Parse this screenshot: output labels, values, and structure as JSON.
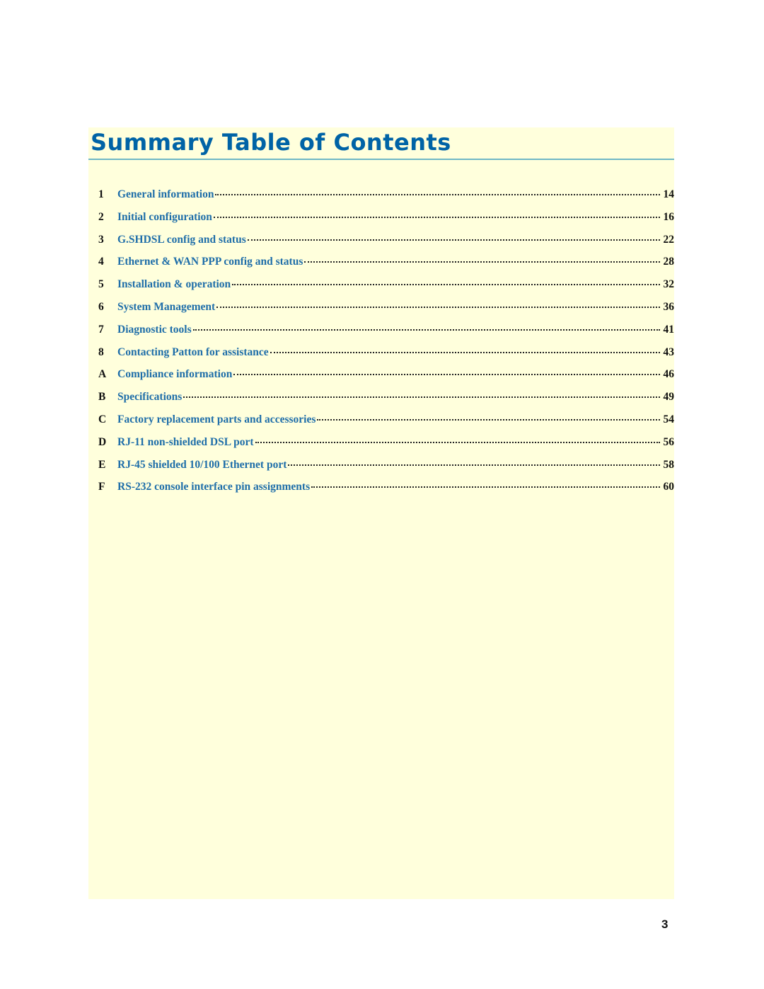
{
  "document": {
    "title": "Summary Table of Contents",
    "page_number": "3",
    "colors": {
      "title": "#0063a6",
      "entry_text": "#1f6ea9",
      "background_panel": "#ffffdc",
      "rule": "#6fb8c6"
    }
  },
  "toc": [
    {
      "num": "1",
      "label": "General information",
      "page": "14"
    },
    {
      "num": "2",
      "label": "Initial configuration",
      "page": "16"
    },
    {
      "num": "3",
      "label": "G.SHDSL config and status",
      "page": "22"
    },
    {
      "num": "4",
      "label": "Ethernet & WAN PPP config and status",
      "page": "28"
    },
    {
      "num": "5",
      "label": "Installation & operation",
      "page": "32"
    },
    {
      "num": "6",
      "label": "System Management",
      "page": "36"
    },
    {
      "num": "7",
      "label": "Diagnostic tools",
      "page": "41"
    },
    {
      "num": "8",
      "label": "Contacting Patton for assistance",
      "page": "43"
    },
    {
      "num": "A",
      "label": "Compliance information",
      "page": "46"
    },
    {
      "num": "B",
      "label": "Specifications",
      "page": "49"
    },
    {
      "num": "C",
      "label": "Factory replacement parts and accessories",
      "page": "54"
    },
    {
      "num": "D",
      "label": "RJ-11 non-shielded DSL port",
      "page": "56"
    },
    {
      "num": "E",
      "label": "RJ-45 shielded 10/100 Ethernet port",
      "page": "58"
    },
    {
      "num": "F",
      "label": "RS-232 console interface pin assignments",
      "page": "60"
    }
  ]
}
